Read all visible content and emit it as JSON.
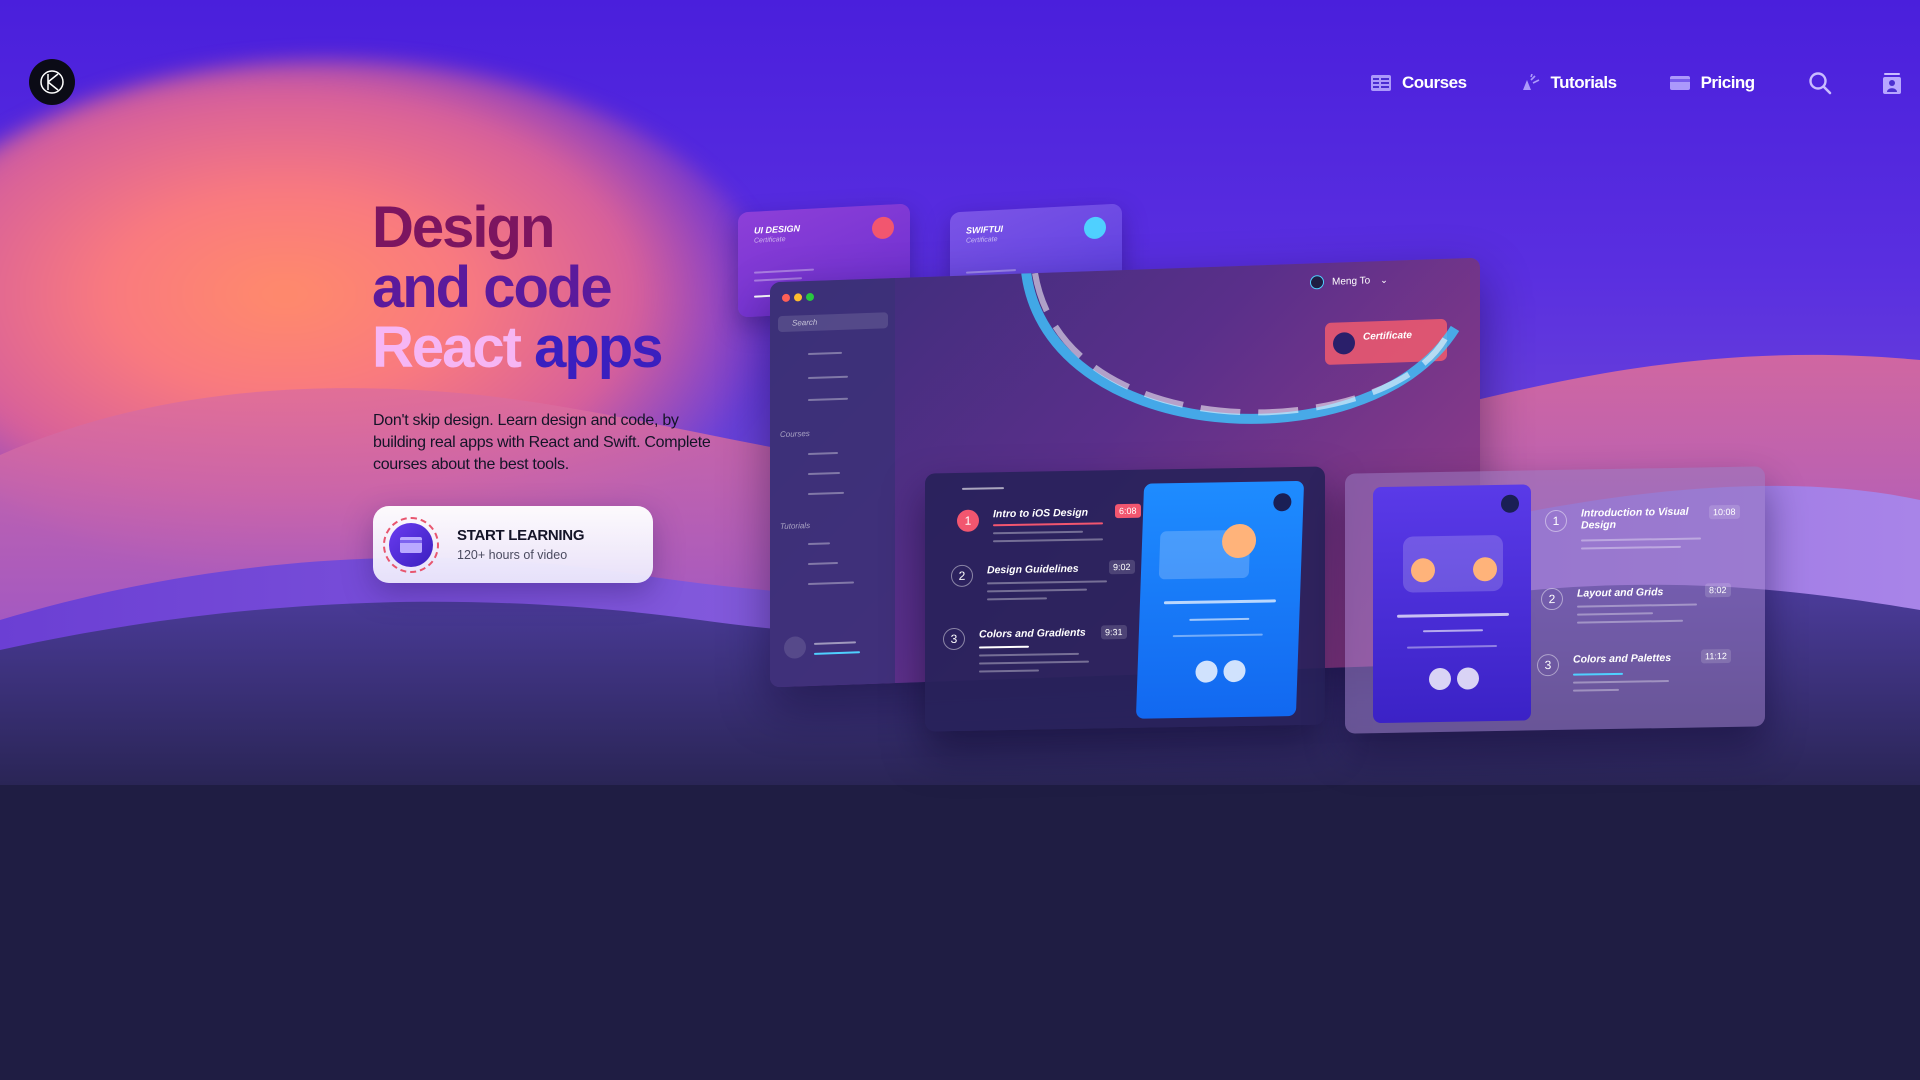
{
  "nav": {
    "logo_icon": "k-logo-icon",
    "items": [
      {
        "label": "Courses",
        "icon": "courses-icon"
      },
      {
        "label": "Tutorials",
        "icon": "tutorials-icon"
      },
      {
        "label": "Pricing",
        "icon": "pricing-icon"
      }
    ],
    "search_icon": "search-icon",
    "account_icon": "account-icon"
  },
  "hero": {
    "line1": "Design",
    "line2": "and code",
    "line3_a": "React",
    "line3_b": "apps",
    "subtext": "Don't skip design. Learn design and code, by building real apps with React and Swift. Complete courses about the best tools.",
    "cta": {
      "title": "START LEARNING",
      "subtitle": "120+ hours of video"
    }
  },
  "mockup": {
    "cert_cards": [
      {
        "title": "UI DESIGN",
        "subtitle": "Certificate"
      },
      {
        "title": "SWIFTUI",
        "subtitle": "Certificate"
      }
    ],
    "app": {
      "search_placeholder": "Search",
      "section_courses": "Courses",
      "section_tutorials": "Tutorials",
      "user_name": "Meng To",
      "certificate_label": "Certificate"
    },
    "list_a": [
      {
        "num": "1",
        "title": "Intro to iOS Design",
        "duration": "6:08"
      },
      {
        "num": "2",
        "title": "Design Guidelines",
        "duration": "9:02"
      },
      {
        "num": "3",
        "title": "Colors and Gradients",
        "duration": "9:31"
      }
    ],
    "list_b": [
      {
        "num": "1",
        "title": "Introduction to Visual Design",
        "duration": "10:08"
      },
      {
        "num": "2",
        "title": "Layout and Grids",
        "duration": "8:02"
      },
      {
        "num": "3",
        "title": "Colors and Palettes",
        "duration": "11:12"
      }
    ]
  },
  "colors": {
    "hero_top": "#4a1fdc",
    "bottom_bg": "#1f1d43",
    "glow": "#ff8a6b",
    "accent_red": "#f2566f"
  }
}
